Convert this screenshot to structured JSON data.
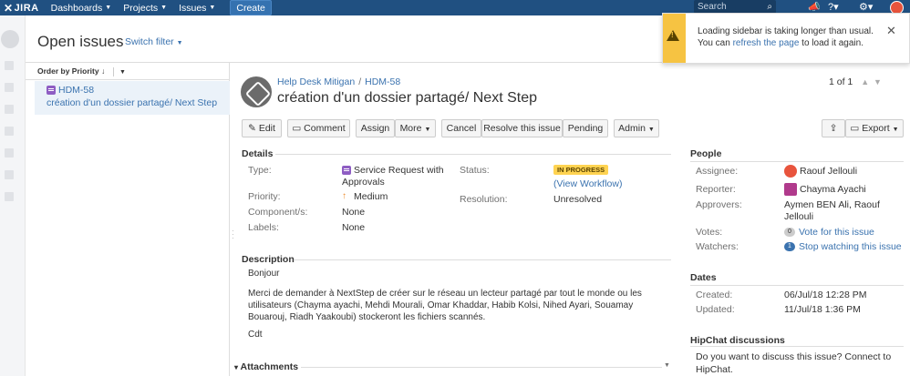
{
  "topbar": {
    "logo_text": "JIRA",
    "nav": [
      {
        "label": "Dashboards"
      },
      {
        "label": "Projects"
      },
      {
        "label": "Issues"
      }
    ],
    "create_label": "Create",
    "search_placeholder": "Search"
  },
  "header": {
    "title": "Open issues",
    "switch_filter": "Switch filter"
  },
  "list": {
    "order_by": "Order by Priority",
    "items": [
      {
        "key": "HDM-58",
        "summary": "création d'un dossier partagé/ Next Step"
      }
    ]
  },
  "issue": {
    "project": "Help Desk Mitigan",
    "key": "HDM-58",
    "title": "création d'un dossier partagé/ Next Step",
    "pager": "1 of 1"
  },
  "toolbar": {
    "edit": "Edit",
    "comment": "Comment",
    "assign": "Assign",
    "more": "More",
    "cancel": "Cancel",
    "resolve": "Resolve this issue",
    "pending": "Pending",
    "admin": "Admin",
    "export": "Export"
  },
  "details": {
    "section_title": "Details",
    "type_label": "Type:",
    "type_value_line1": "Service Request with",
    "type_value_line2": "Approvals",
    "priority_label": "Priority:",
    "priority_value": "Medium",
    "components_label": "Component/s:",
    "components_value": "None",
    "labels_label": "Labels:",
    "labels_value": "None",
    "status_label": "Status:",
    "status_value": "IN PROGRESS",
    "view_workflow": "(View Workflow)",
    "resolution_label": "Resolution:",
    "resolution_value": "Unresolved"
  },
  "description": {
    "section_title": "Description",
    "greeting": "Bonjour",
    "body": "Merci de demander à NextStep de créer sur le réseau un lecteur partagé par tout le monde ou les utilisateurs (Chayma ayachi, Mehdi Mourali, Omar Khaddar, Habib Kolsi, Nihed Ayari, Souamay Bouarouj, Riadh Yaakoubi) stockeront les fichiers scannés.",
    "closing": "Cdt"
  },
  "attachments": {
    "section_title": "Attachments"
  },
  "people": {
    "section_title": "People",
    "assignee_label": "Assignee:",
    "assignee_value": "Raouf Jellouli",
    "reporter_label": "Reporter:",
    "reporter_value": "Chayma Ayachi",
    "approvers_label": "Approvers:",
    "approvers_line1": "Aymen BEN Ali, Raouf",
    "approvers_line2": "Jellouli",
    "votes_label": "Votes:",
    "votes_count": "0",
    "votes_link": "Vote for this issue",
    "watchers_label": "Watchers:",
    "watchers_count": "1",
    "watchers_link": "Stop watching this issue"
  },
  "dates": {
    "section_title": "Dates",
    "created_label": "Created:",
    "created_value": "06/Jul/18 12:28 PM",
    "updated_label": "Updated:",
    "updated_value": "11/Jul/18 1:36 PM"
  },
  "hipchat": {
    "section_title": "HipChat discussions",
    "line1": "Do you want to discuss this issue? Connect to",
    "line2": "HipChat."
  },
  "flag": {
    "text_before": "Loading sidebar is taking longer than usual. You can ",
    "link": "refresh the page",
    "text_after": " to load it again."
  }
}
